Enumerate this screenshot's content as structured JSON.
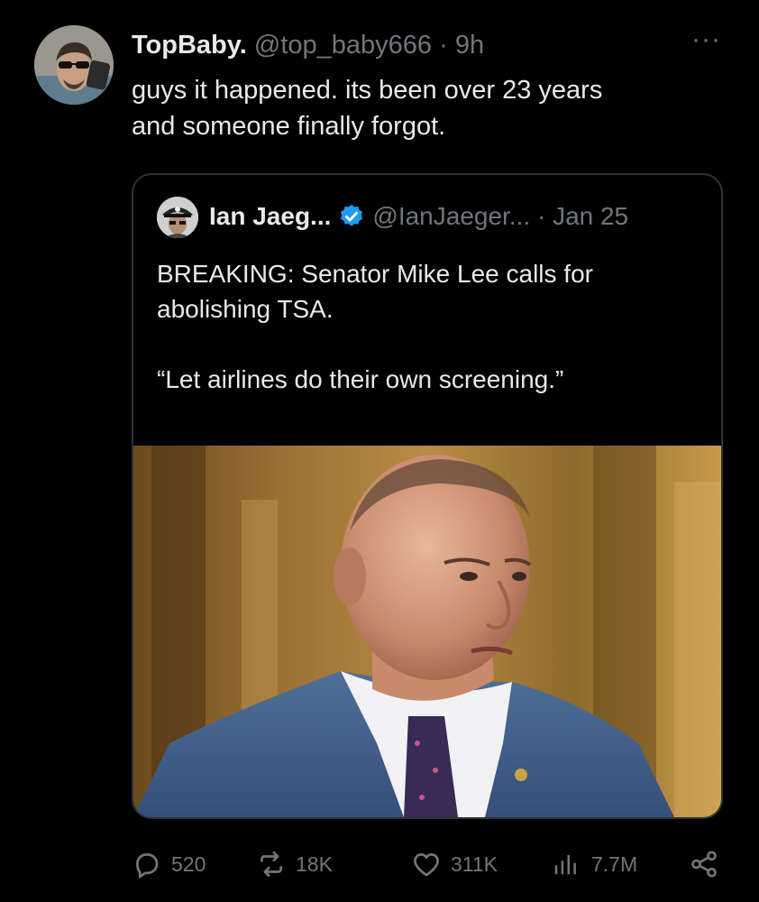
{
  "post": {
    "display_name": "TopBaby.",
    "handle": "@top_baby666",
    "separator": "·",
    "time": "9h",
    "more_label": "···",
    "text": "guys it happened. its been over 23 years\nand someone finally forgot.",
    "avatar_icon": "profile-photo"
  },
  "quoted": {
    "display_name": "Ian Jaeg...",
    "handle": "@IanJaeger...",
    "separator": "·",
    "date": "Jan 25",
    "verified_icon": "verified-badge",
    "verified_color": "#1d9bf0",
    "text": "BREAKING: Senator Mike Lee calls for\nabolishing TSA.\n\n“Let airlines do their own screening.”",
    "media_icon": "photo-man-in-suit"
  },
  "actions": {
    "replies": "520",
    "reposts": "18K",
    "likes": "311K",
    "views": "7.7M",
    "icons": [
      "reply-icon",
      "repost-icon",
      "like-icon",
      "views-icon",
      "share-icon"
    ]
  },
  "colors": {
    "background": "#000000",
    "text_primary": "#e7e9ea",
    "text_secondary": "#71767b",
    "border": "#2f3336",
    "accent": "#1d9bf0"
  }
}
